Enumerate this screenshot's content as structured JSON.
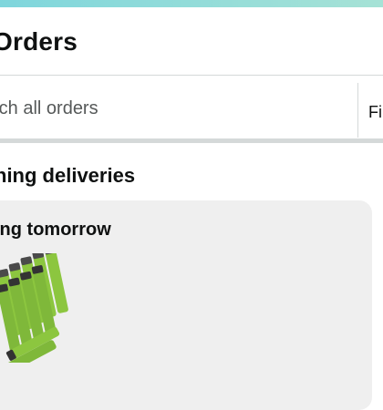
{
  "header": {
    "title": "Orders"
  },
  "search": {
    "placeholder": "rch all orders",
    "filter_label": "Fi"
  },
  "upcoming": {
    "section_title": "ning deliveries",
    "card": {
      "status": "ing tomorrow",
      "product_image": "battery-pack-product-image"
    }
  },
  "colors": {
    "top_strip": "#7fd6dc",
    "card_bg": "#efefef",
    "divider": "#d5d9d9",
    "battery_green": "#8cc63f"
  }
}
